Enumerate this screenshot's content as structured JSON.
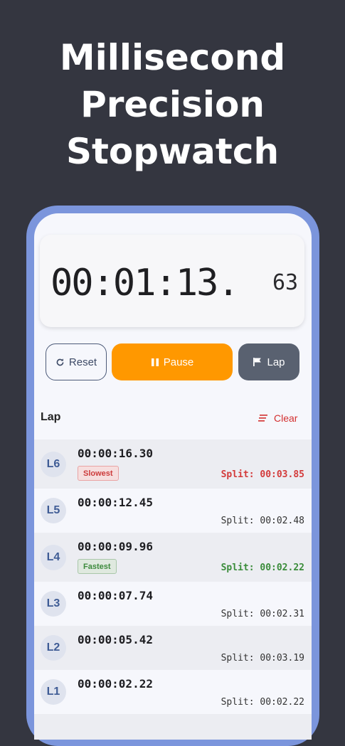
{
  "headline": [
    "Millisecond",
    "Precision",
    "Stopwatch"
  ],
  "timer": {
    "main": "00:01:13.",
    "ms": "63"
  },
  "controls": {
    "reset": "Reset",
    "pause": "Pause",
    "lap": "Lap"
  },
  "list": {
    "title": "Lap",
    "clear": "Clear"
  },
  "laps": [
    {
      "id": "L6",
      "time": "00:00:16.30",
      "tag": "Slowest",
      "split": "Split: 00:03.85",
      "kind": "slow"
    },
    {
      "id": "L5",
      "time": "00:00:12.45",
      "tag": "",
      "split": "Split: 00:02.48",
      "kind": ""
    },
    {
      "id": "L4",
      "time": "00:00:09.96",
      "tag": "Fastest",
      "split": "Split: 00:02.22",
      "kind": "fast"
    },
    {
      "id": "L3",
      "time": "00:00:07.74",
      "tag": "",
      "split": "Split: 00:02.31",
      "kind": ""
    },
    {
      "id": "L2",
      "time": "00:00:05.42",
      "tag": "",
      "split": "Split: 00:03.19",
      "kind": ""
    },
    {
      "id": "L1",
      "time": "00:00:02.22",
      "tag": "",
      "split": "Split: 00:02.22",
      "kind": ""
    }
  ],
  "colors": {
    "background": "#343640",
    "phone_frame": "#7b95dc",
    "pause_button": "#ff9800",
    "lap_button": "#596170",
    "slowest": "#d32f2f",
    "fastest": "#3a8c3a"
  },
  "icons": {
    "reset": "refresh-icon",
    "pause": "pause-icon",
    "lap": "flag-icon",
    "clear": "clear-list-icon"
  }
}
